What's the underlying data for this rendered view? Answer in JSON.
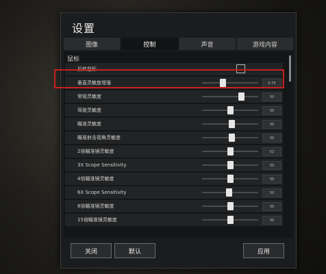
{
  "dialog": {
    "title": "设置"
  },
  "tabs": [
    {
      "label": "图像",
      "active": false
    },
    {
      "label": "控制",
      "active": true
    },
    {
      "label": "声音",
      "active": false
    },
    {
      "label": "游戏内容",
      "active": false
    }
  ],
  "section": {
    "label": "鼠标"
  },
  "rows": [
    {
      "label": "反转鼠标",
      "type": "checkbox",
      "checked": false
    },
    {
      "label": "垂直灵敏度增强",
      "type": "slider",
      "level_fraction": 0.36,
      "value": "0.75",
      "highlighted": true
    },
    {
      "label": "常规灵敏度",
      "type": "slider",
      "level_fraction": 0.7,
      "value": "50"
    },
    {
      "label": "驾驶灵敏度",
      "type": "slider",
      "level_fraction": 0.5,
      "value": "50"
    },
    {
      "label": "瞄准灵敏度",
      "type": "slider",
      "level_fraction": 0.52,
      "value": "50"
    },
    {
      "label": "瞄准射击视角灵敏度",
      "type": "slider",
      "level_fraction": 0.52,
      "value": "50"
    },
    {
      "label": "2倍瞄准镜灵敏度",
      "type": "slider",
      "level_fraction": 0.5,
      "value": "52"
    },
    {
      "label": "3X Scope Sensitivity",
      "type": "slider",
      "level_fraction": 0.5,
      "value": "50"
    },
    {
      "label": "4倍瞄准镜灵敏度",
      "type": "slider",
      "level_fraction": 0.5,
      "value": "50"
    },
    {
      "label": "6X Scope Sensitivity",
      "type": "slider",
      "level_fraction": 0.48,
      "value": "50"
    },
    {
      "label": "8倍瞄准镜灵敏度",
      "type": "slider",
      "level_fraction": 0.5,
      "value": "50"
    },
    {
      "label": "15倍瞄准镜灵敏度",
      "type": "slider",
      "level_fraction": 0.5,
      "value": "50"
    }
  ],
  "buttons": {
    "close": "关闭",
    "default": "默认",
    "apply": "应用"
  }
}
